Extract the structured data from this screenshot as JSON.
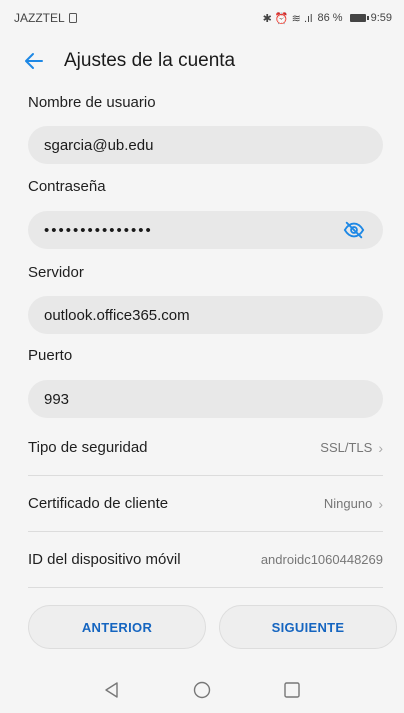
{
  "status_bar": {
    "carrier": "JAZZTEL",
    "icons": "✱ ⏰ ≋ .ıl",
    "battery_text": "86 %",
    "time": "9:59"
  },
  "app_bar": {
    "title": "Ajustes de la cuenta",
    "back_icon": "arrow-left-icon",
    "accent": "#1e88e5"
  },
  "form": {
    "username": {
      "label": "Nombre de usuario",
      "value": "sgarcia@ub.edu"
    },
    "password": {
      "label": "Contraseña",
      "value": "•••••••••••••••",
      "toggle_icon": "eye-off-icon"
    },
    "server": {
      "label": "Servidor",
      "value": "outlook.office365.com"
    },
    "port": {
      "label": "Puerto",
      "value": "993"
    }
  },
  "settings": {
    "security": {
      "label": "Tipo de seguridad",
      "value": "SSL/TLS"
    },
    "client_cert": {
      "label": "Certificado de cliente",
      "value": "Ninguno"
    },
    "device_id": {
      "label": "ID del dispositivo móvil",
      "value": "androidc1060448269"
    }
  },
  "buttons": {
    "previous": "ANTERIOR",
    "next": "SIGUIENTE",
    "text_color": "#1565c0"
  },
  "nav": {
    "back": "triangle-back-icon",
    "home": "circle-home-icon",
    "recents": "square-recents-icon"
  }
}
